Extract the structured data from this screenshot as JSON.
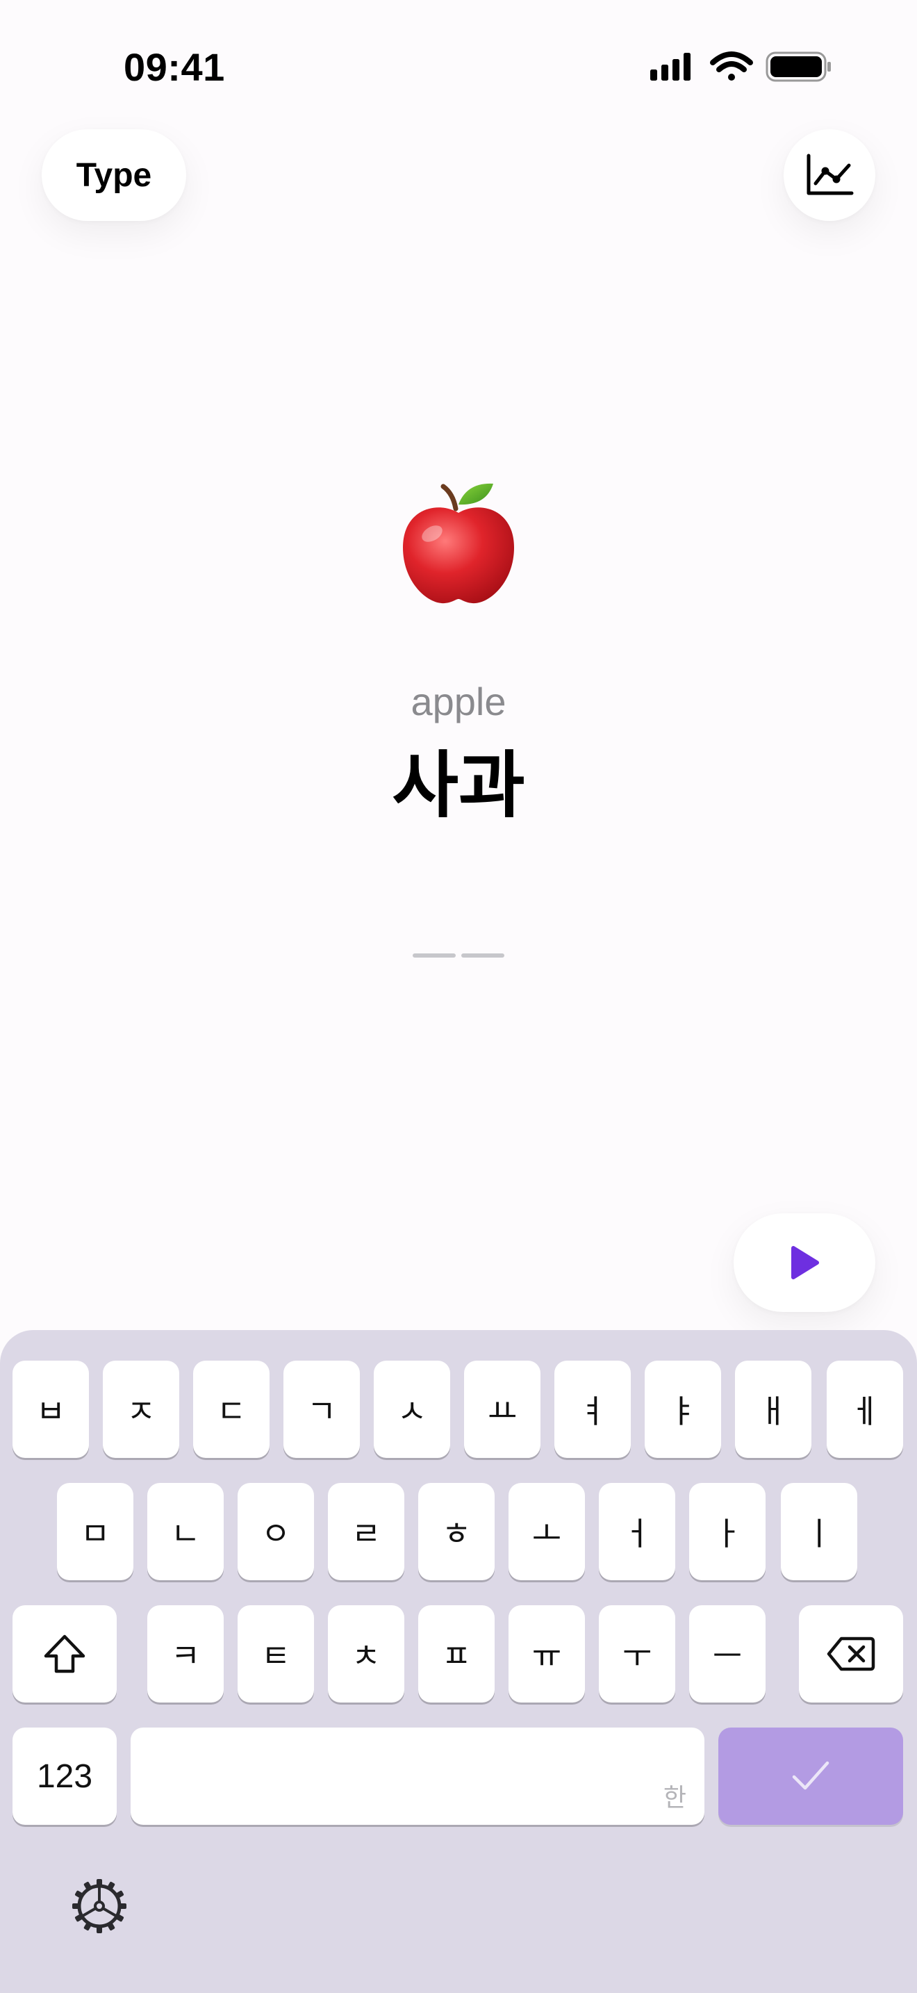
{
  "status_bar": {
    "time": "09:41",
    "icons": [
      "cellular-signal-icon",
      "wifi-icon",
      "battery-icon"
    ]
  },
  "toolbar": {
    "type_label": "Type",
    "stats_icon": "line-chart-icon"
  },
  "card": {
    "emoji": "apple-emoji",
    "english": "apple",
    "korean": "사과",
    "answer_slots": 2
  },
  "play_icon": "play-icon",
  "keyboard": {
    "row1": [
      "ㅂ",
      "ㅈ",
      "ㄷ",
      "ㄱ",
      "ㅅ",
      "ㅛ",
      "ㅕ",
      "ㅑ",
      "ㅐ",
      "ㅔ"
    ],
    "row2": [
      "ㅁ",
      "ㄴ",
      "ㅇ",
      "ㄹ",
      "ㅎ",
      "ㅗ",
      "ㅓ",
      "ㅏ",
      "ㅣ"
    ],
    "row3": [
      "ㅋ",
      "ㅌ",
      "ㅊ",
      "ㅍ",
      "ㅠ",
      "ㅜ",
      "ㅡ"
    ],
    "numbers_label": "123",
    "space_hint": "한",
    "shift_icon": "shift-icon",
    "delete_icon": "delete-icon",
    "done_icon": "checkmark-icon",
    "settings_icon": "gear-icon",
    "colors": {
      "background": "#dcd8e6",
      "key": "#ffffff",
      "done_key": "#b39be3"
    }
  },
  "colors": {
    "accent": "#6e2fe0",
    "english_text": "#8a8a8e",
    "blank_line": "#c7c7cb"
  }
}
